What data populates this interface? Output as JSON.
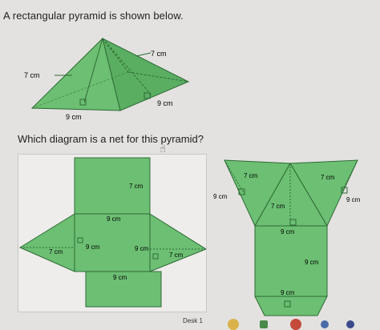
{
  "question": "A rectangular pyramid is shown below.",
  "prompt": "Which diagram is a net for this pyramid?",
  "pyramid": {
    "label_top": "7 cm",
    "label_left": "7 cm",
    "label_slant": "9 cm",
    "label_base": "9 cm"
  },
  "option_a": {
    "label_rect_top": "7 cm",
    "label_center_top": "9 cm",
    "label_left_tri": "7 cm",
    "label_left_height": "9 cm",
    "label_right_height": "9 cm",
    "label_right_tri": "7 cm",
    "label_bottom": "9 cm"
  },
  "option_b": {
    "label_top_left": "7 cm",
    "label_top_right": "7 cm",
    "label_left": "9 cm",
    "label_right": "9 cm",
    "label_center": "7 cm",
    "label_below_center": "9 cm",
    "label_rect_side": "9 cm",
    "label_bottom": "9 cm"
  },
  "taskbar": {
    "desk_label": "Desk 1"
  },
  "colors": {
    "face": "#6cbf73",
    "face_dark": "#5aae62",
    "stroke": "#2e6b35",
    "background": "#e3e2e0"
  }
}
